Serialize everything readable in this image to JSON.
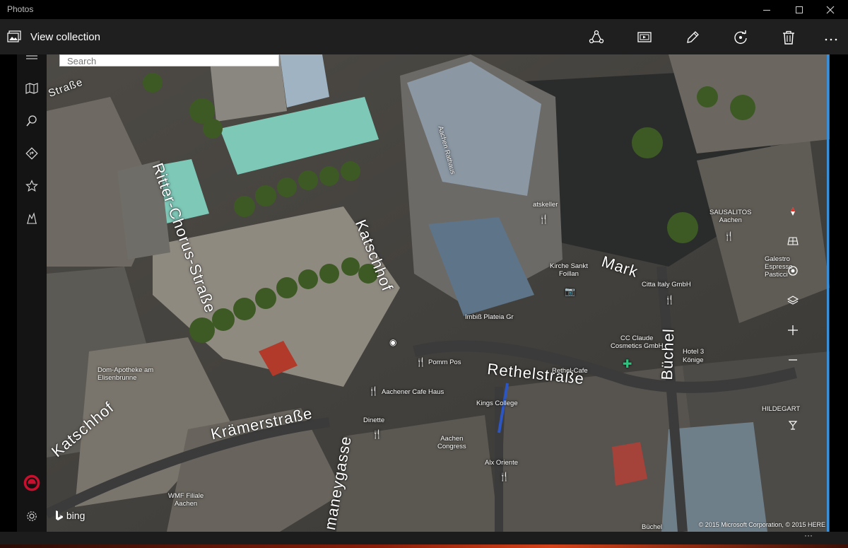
{
  "window": {
    "app_title": "Photos",
    "minimize_icon": "minimize-icon",
    "maximize_icon": "maximize-icon",
    "close_icon": "close-icon"
  },
  "toolbar": {
    "collection_icon": "photo-collection-icon",
    "collection_label": "View collection",
    "actions": [
      "share-icon",
      "slideshow-icon",
      "edit-pencil-icon",
      "rotate-icon",
      "delete-trash-icon",
      "more-ellipsis-icon"
    ]
  },
  "left_rail": {
    "items": [
      "hamburger-menu-icon",
      "map-icon",
      "search-icon",
      "directions-icon",
      "favorites-star-icon",
      "3d-cities-icon"
    ],
    "bottom": [
      "account-avatar-icon",
      "settings-gear-icon"
    ]
  },
  "search": {
    "placeholder": "Search"
  },
  "map": {
    "streets": {
      "ritter": "Ritter-Chorus-Straße",
      "katschhof": "Katschhof",
      "katschhof_left": "Katschhof",
      "krammerstrasse": "Krämerstraße",
      "rethelstrasse": "Rethelstraße",
      "buchel": "Büchel",
      "hof": "Mark",
      "maneygasse": "maneygasse",
      "strasse_left": "Straße"
    },
    "pois": {
      "rathaus": "Aachen Rathaus",
      "ratskeller": "atskeller",
      "imbiss": "Imbiß Plateia Gr",
      "pomm": "Pomm Pos",
      "apotheke": "Dom-Apotheke am\nElisenbrunne",
      "cafehaus": "Aachener Cafe Haus",
      "kingscollege": "Kings College",
      "dinette": "Dinette",
      "aachen_congress": "Aachen\nCongress",
      "alx": "Alx Oriente",
      "wmfiliale": "WMF Filiale\nAachen",
      "kirche": "Kirche Sankt\nFoillan",
      "cittaitaly": "Citta Italy GmbH",
      "ccclaude": "CC Claude\nCosmetics GmbH",
      "hotel3": "Hotel 3\nKönige",
      "rethelcafe": "Rethel-Cafe",
      "sausalitos": "SAUSALITOS\nAachen",
      "galestro": "Galestro\nEspresso\nPasticci",
      "hildegart": "HILDEGART",
      "buchel_bottom": "Büchel"
    },
    "controls": [
      "compass-icon",
      "grid-3d-icon",
      "locate-me-icon",
      "layers-icon",
      "zoom-in-icon",
      "zoom-out-icon"
    ],
    "attribution_logo": "bing",
    "copyright": "© 2015 Microsoft Corporation, © 2015 HERE"
  },
  "colors": {
    "title_bg": "#000000",
    "toolbar_bg": "#1f1f1f",
    "rail_bg": "#141414",
    "accent_blue": "#3a8fd8",
    "account_red": "#c8102e"
  }
}
